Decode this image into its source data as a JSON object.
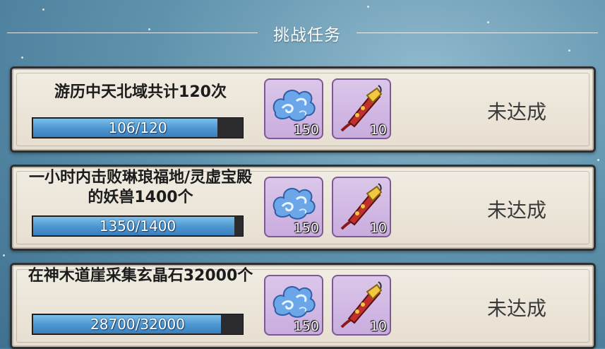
{
  "header": {
    "title": "挑战任务"
  },
  "tasks": [
    {
      "description": "游历中天北域共计120次",
      "progress_text": "106/120",
      "progress_fraction": 0.883,
      "rewards": [
        {
          "icon": "blue-cloud-icon",
          "quantity": "150"
        },
        {
          "icon": "red-scroll-icon",
          "quantity": "10"
        }
      ],
      "status": "未达成"
    },
    {
      "description": "一小时内击败琳琅福地/灵虚宝殿的妖兽1400个",
      "progress_text": "1350/1400",
      "progress_fraction": 0.964,
      "rewards": [
        {
          "icon": "blue-cloud-icon",
          "quantity": "150"
        },
        {
          "icon": "red-scroll-icon",
          "quantity": "10"
        }
      ],
      "status": "未达成"
    },
    {
      "description": "在神木道崖采集玄晶石32000个",
      "progress_text": "28700/32000",
      "progress_fraction": 0.897,
      "rewards": [
        {
          "icon": "blue-cloud-icon",
          "quantity": "150"
        },
        {
          "icon": "red-scroll-icon",
          "quantity": "10"
        }
      ],
      "status": "未达成"
    }
  ],
  "colors": {
    "progress_fill": "#4f98d2",
    "item_frame": "#c9acde",
    "card_bg": "#e6ded0"
  }
}
